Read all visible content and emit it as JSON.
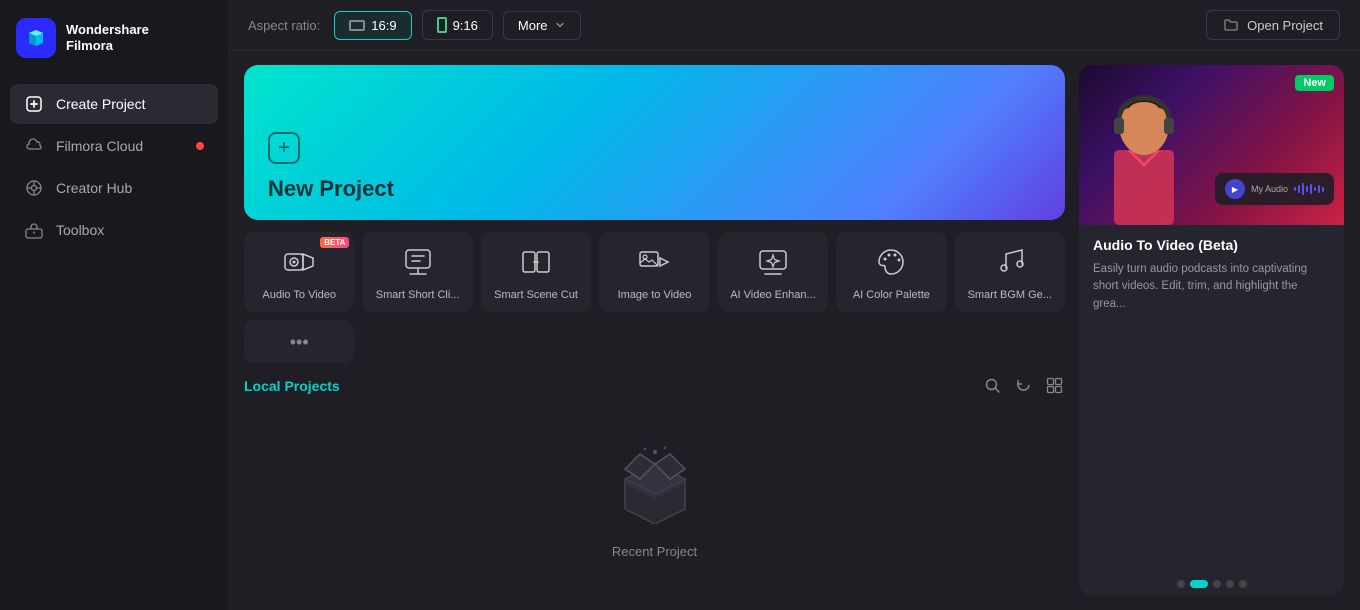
{
  "app": {
    "name": "Wondershare",
    "subname": "Filmora"
  },
  "sidebar": {
    "items": [
      {
        "id": "create-project",
        "label": "Create Project",
        "active": true,
        "notification": false
      },
      {
        "id": "filmora-cloud",
        "label": "Filmora Cloud",
        "active": false,
        "notification": true
      },
      {
        "id": "creator-hub",
        "label": "Creator Hub",
        "active": false,
        "notification": false
      },
      {
        "id": "toolbox",
        "label": "Toolbox",
        "active": false,
        "notification": false
      }
    ]
  },
  "aspect_ratio": {
    "label": "Aspect ratio:",
    "options": [
      {
        "id": "16-9",
        "label": "16:9",
        "active": true
      },
      {
        "id": "9-16",
        "label": "9:16",
        "active": false
      }
    ],
    "more_label": "More",
    "open_project_label": "Open Project"
  },
  "new_project": {
    "title": "New Project"
  },
  "ai_tools": [
    {
      "id": "audio-to-video",
      "label": "Audio To Video",
      "beta": true,
      "icon": "🎵"
    },
    {
      "id": "smart-short-clip",
      "label": "Smart Short Cli...",
      "beta": false,
      "icon": "✂"
    },
    {
      "id": "smart-scene-cut",
      "label": "Smart Scene Cut",
      "beta": false,
      "icon": "🎬"
    },
    {
      "id": "image-to-video",
      "label": "Image to Video",
      "beta": false,
      "icon": "🖼"
    },
    {
      "id": "ai-video-enhance",
      "label": "AI Video Enhan...",
      "beta": false,
      "icon": "✨"
    },
    {
      "id": "ai-color-palette",
      "label": "AI Color Palette",
      "beta": false,
      "icon": "🎨"
    },
    {
      "id": "smart-bgm-gen",
      "label": "Smart BGM Ge...",
      "beta": false,
      "icon": "🎵"
    }
  ],
  "local_projects": {
    "title": "Local Projects",
    "empty_label": "Recent Project",
    "actions": [
      "search",
      "refresh",
      "grid-view"
    ]
  },
  "promo_card": {
    "badge": "New",
    "title": "Audio To Video (Beta)",
    "description": "Easily turn audio podcasts into captivating short videos. Edit, trim, and highlight the grea...",
    "audio_label": "My Audio",
    "dots_count": 5,
    "active_dot": 1
  }
}
